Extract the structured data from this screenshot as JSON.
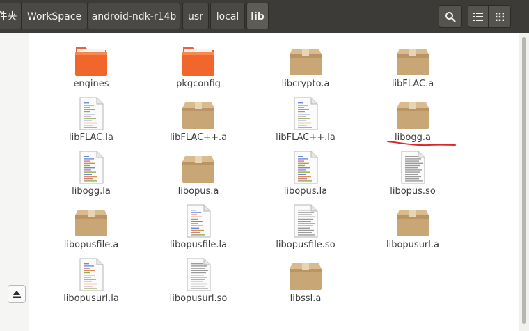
{
  "window": {
    "breadcrumbs": [
      {
        "label": "件夹"
      },
      {
        "label": "WorkSpace"
      },
      {
        "label": "android-ndk-r14b"
      },
      {
        "label": "usr"
      },
      {
        "label": "local"
      },
      {
        "label": "lib"
      }
    ]
  },
  "toolbar": {
    "search_icon": "search-icon",
    "list_icon": "list-view-icon",
    "grid_icon": "grid-view-icon",
    "accent": "#3c3b37"
  },
  "sidebar": {
    "eject_icon": "eject-icon"
  },
  "files": [
    {
      "name": "engines",
      "type": "folder"
    },
    {
      "name": "pkgconfig",
      "type": "folder"
    },
    {
      "name": "libcrypto.a",
      "type": "archive"
    },
    {
      "name": "libFLAC.a",
      "type": "archive"
    },
    {
      "name": "libFLAC.la",
      "type": "text"
    },
    {
      "name": "libFLAC++.a",
      "type": "archive"
    },
    {
      "name": "libFLAC++.la",
      "type": "text"
    },
    {
      "name": "libogg.a",
      "type": "archive",
      "annotated": true
    },
    {
      "name": "libogg.la",
      "type": "text"
    },
    {
      "name": "libopus.a",
      "type": "archive"
    },
    {
      "name": "libopus.la",
      "type": "text"
    },
    {
      "name": "libopus.so",
      "type": "binary"
    },
    {
      "name": "libopusfile.a",
      "type": "archive"
    },
    {
      "name": "libopusfile.la",
      "type": "text"
    },
    {
      "name": "libopusfile.so",
      "type": "binary"
    },
    {
      "name": "libopusurl.a",
      "type": "archive"
    },
    {
      "name": "libopusurl.la",
      "type": "text"
    },
    {
      "name": "libopusurl.so",
      "type": "binary"
    },
    {
      "name": "libssl.a",
      "type": "archive"
    }
  ],
  "annotation": {
    "color": "#e0242b"
  }
}
